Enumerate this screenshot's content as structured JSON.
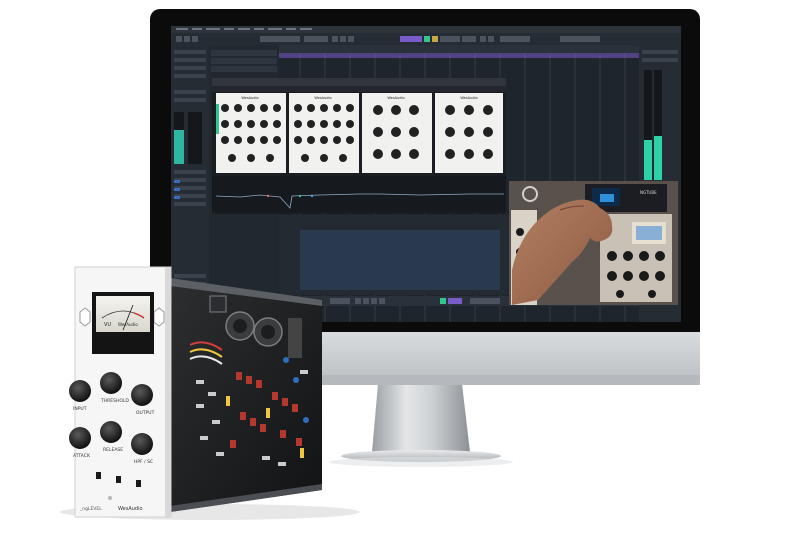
{
  "image": {
    "description_type": "product-photo"
  },
  "monitor": {
    "daw": {
      "colors": {
        "bg": "#1f252d",
        "panel": "#2a313a",
        "grid": "#323a44",
        "accent_green": "#33c48f",
        "accent_purple": "#7a5cc9"
      }
    },
    "plugin_windows": [
      {
        "logo": "WesAudio"
      },
      {
        "logo": "WesAudio"
      },
      {
        "logo": "WesAudio"
      },
      {
        "logo": "WesAudio"
      }
    ],
    "video_inset": {
      "device_text": "NGTUBE"
    }
  },
  "hardware_module": {
    "vu_meter": {
      "scale_left": "VU",
      "scale_right": "WesAudio"
    },
    "knob_labels": [
      "INPUT",
      "THRESHOLD",
      "OUTPUT",
      "ATTACK",
      "RELEASE",
      "HPF / SC"
    ],
    "footer_brand": "WesAudio",
    "footer_model": "_ngLEVEL"
  }
}
